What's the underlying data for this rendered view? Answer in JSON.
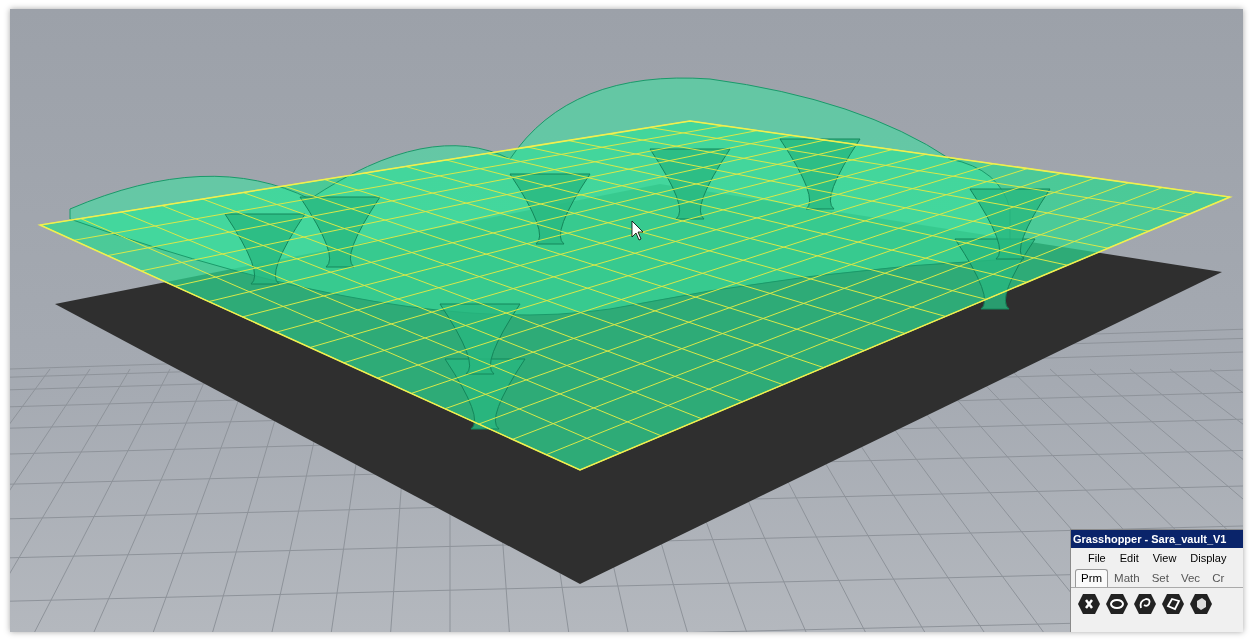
{
  "grasshopper": {
    "title": "Grasshopper - Sara_vault_V1",
    "menu": [
      "File",
      "Edit",
      "View",
      "Display"
    ],
    "tabs": [
      {
        "label": "Prm",
        "selected": true
      },
      {
        "label": "Math",
        "selected": false
      },
      {
        "label": "Set",
        "selected": false
      },
      {
        "label": "Vec",
        "selected": false
      },
      {
        "label": "Cr",
        "selected": false
      }
    ]
  }
}
